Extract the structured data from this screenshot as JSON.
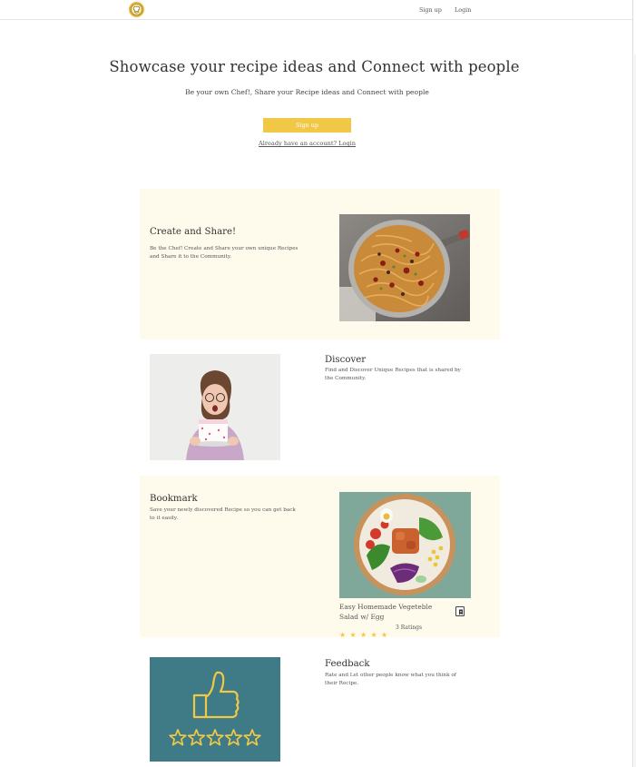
{
  "header": {
    "signup_label": "Sign up",
    "login_label": "Login"
  },
  "hero": {
    "title": "Showcase your recipe ideas and Connect with people",
    "subtitle": "Be your own Chef!, Share your Recipe ideas and Connect with people",
    "signup_button": "Sign up",
    "login_link": "Already have an account? Login"
  },
  "features": [
    {
      "title": "Create and Share!",
      "description": "Be the Chef! Create and Share your own unique Recipes and  Share it to the Community.",
      "image_icon": "pasta-pan-photo"
    },
    {
      "title": "Discover",
      "description": "Find and Discover Unique Recipes that is shared by the Community.",
      "image_icon": "woman-with-cake-photo"
    },
    {
      "title": "Bookmark",
      "description": "Save your newly discovered Recipe so you can get back to it easily.",
      "image_icon": "salad-bowl-photo"
    },
    {
      "title": "Feedback",
      "description": "Rate and Let other people know what you think of their Recipe.",
      "image_icon": "thumbs-up-stars-illustration"
    }
  ],
  "recipe_card": {
    "title": "Easy Homemade Vegeteble Salad w/ Egg",
    "rating": 5,
    "ratings_label": "3 Ratings"
  },
  "colors": {
    "accent": "#f0c846",
    "band": "#fffbec",
    "feedback_bg": "#3f7b86"
  }
}
